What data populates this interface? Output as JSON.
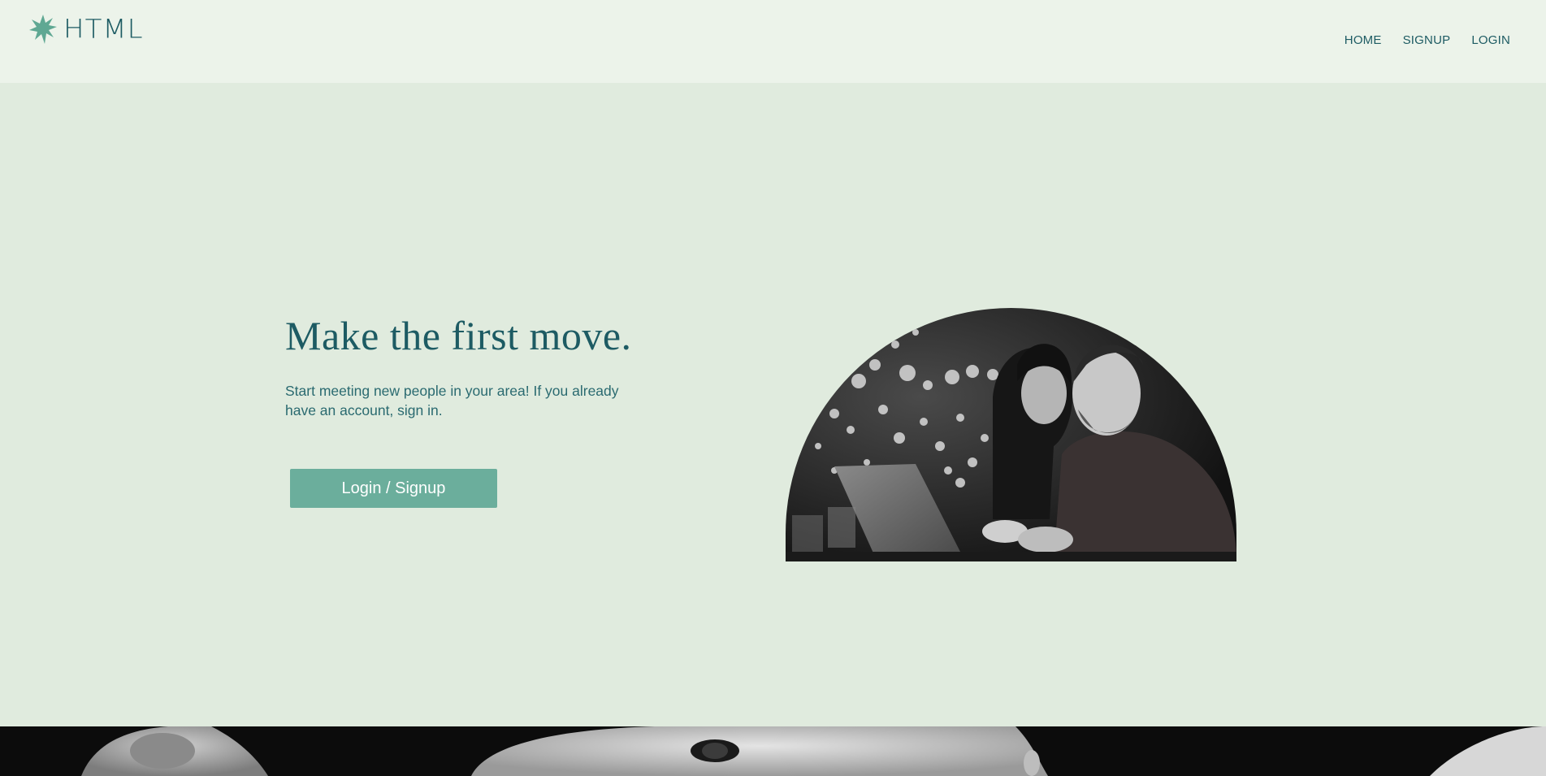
{
  "header": {
    "logo_text": "HTML",
    "logo_icon": "star-burst-icon",
    "nav": [
      "HOME",
      "SIGNUP",
      "LOGIN"
    ]
  },
  "hero": {
    "title": "Make the first move.",
    "subtitle": "Start meeting new people in your area! If you already have an account, sign in.",
    "cta_label": "Login / Signup"
  },
  "colors": {
    "page_bg": "#e0ebde",
    "header_bg": "#ecf3ea",
    "text": "#1d5b63",
    "accent": "#6bae9c"
  }
}
